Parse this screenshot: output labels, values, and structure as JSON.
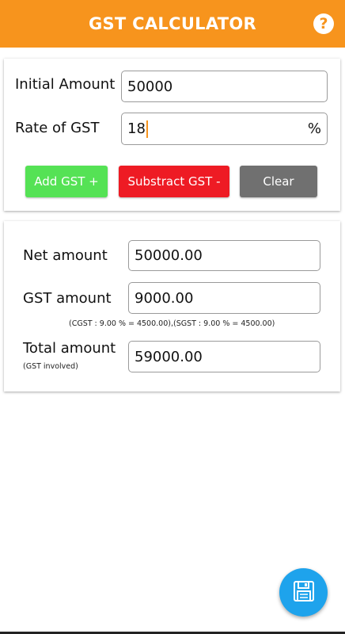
{
  "header": {
    "title": "GST CALCULATOR",
    "help_icon": "question-circle-icon"
  },
  "input_card": {
    "initial_amount_label": "Initial Amount",
    "initial_amount_value": "50000",
    "rate_label": "Rate of GST",
    "rate_value": "18",
    "rate_unit": "%",
    "add_button": "Add GST +",
    "subtract_button": "Substract GST -",
    "clear_button": "Clear"
  },
  "result_card": {
    "net_label": "Net amount",
    "net_value": "50000.00",
    "gst_label": "GST amount",
    "gst_value": "9000.00",
    "gst_breakdown": "(CGST : 9.00 % = 4500.00),(SGST : 9.00 % = 4500.00)",
    "total_label": "Total amount",
    "total_sublabel": "(GST involved)",
    "total_value": "59000.00"
  },
  "fab": {
    "icon": "save-floppy-icon"
  },
  "colors": {
    "appbar": "#f7941d",
    "add": "#55e255",
    "subtract": "#ee1b24",
    "clear": "#707070",
    "fab": "#1ea3ec"
  }
}
